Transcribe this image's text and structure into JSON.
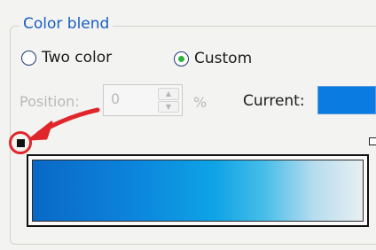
{
  "group": {
    "title": "Color blend"
  },
  "radios": [
    {
      "label": "Two color",
      "selected": false
    },
    {
      "label": "Custom",
      "selected": true
    }
  ],
  "position": {
    "label": "Position:",
    "value": "0",
    "unit": "%",
    "enabled": false
  },
  "current": {
    "label": "Current:",
    "color": "#0a7be0"
  },
  "gradient": {
    "colors": [
      "#0a68c6",
      "#0ea3e6",
      "#e8eff2"
    ]
  },
  "annotation": {
    "color": "#e0262a",
    "icon": "red-arrow-icon"
  }
}
